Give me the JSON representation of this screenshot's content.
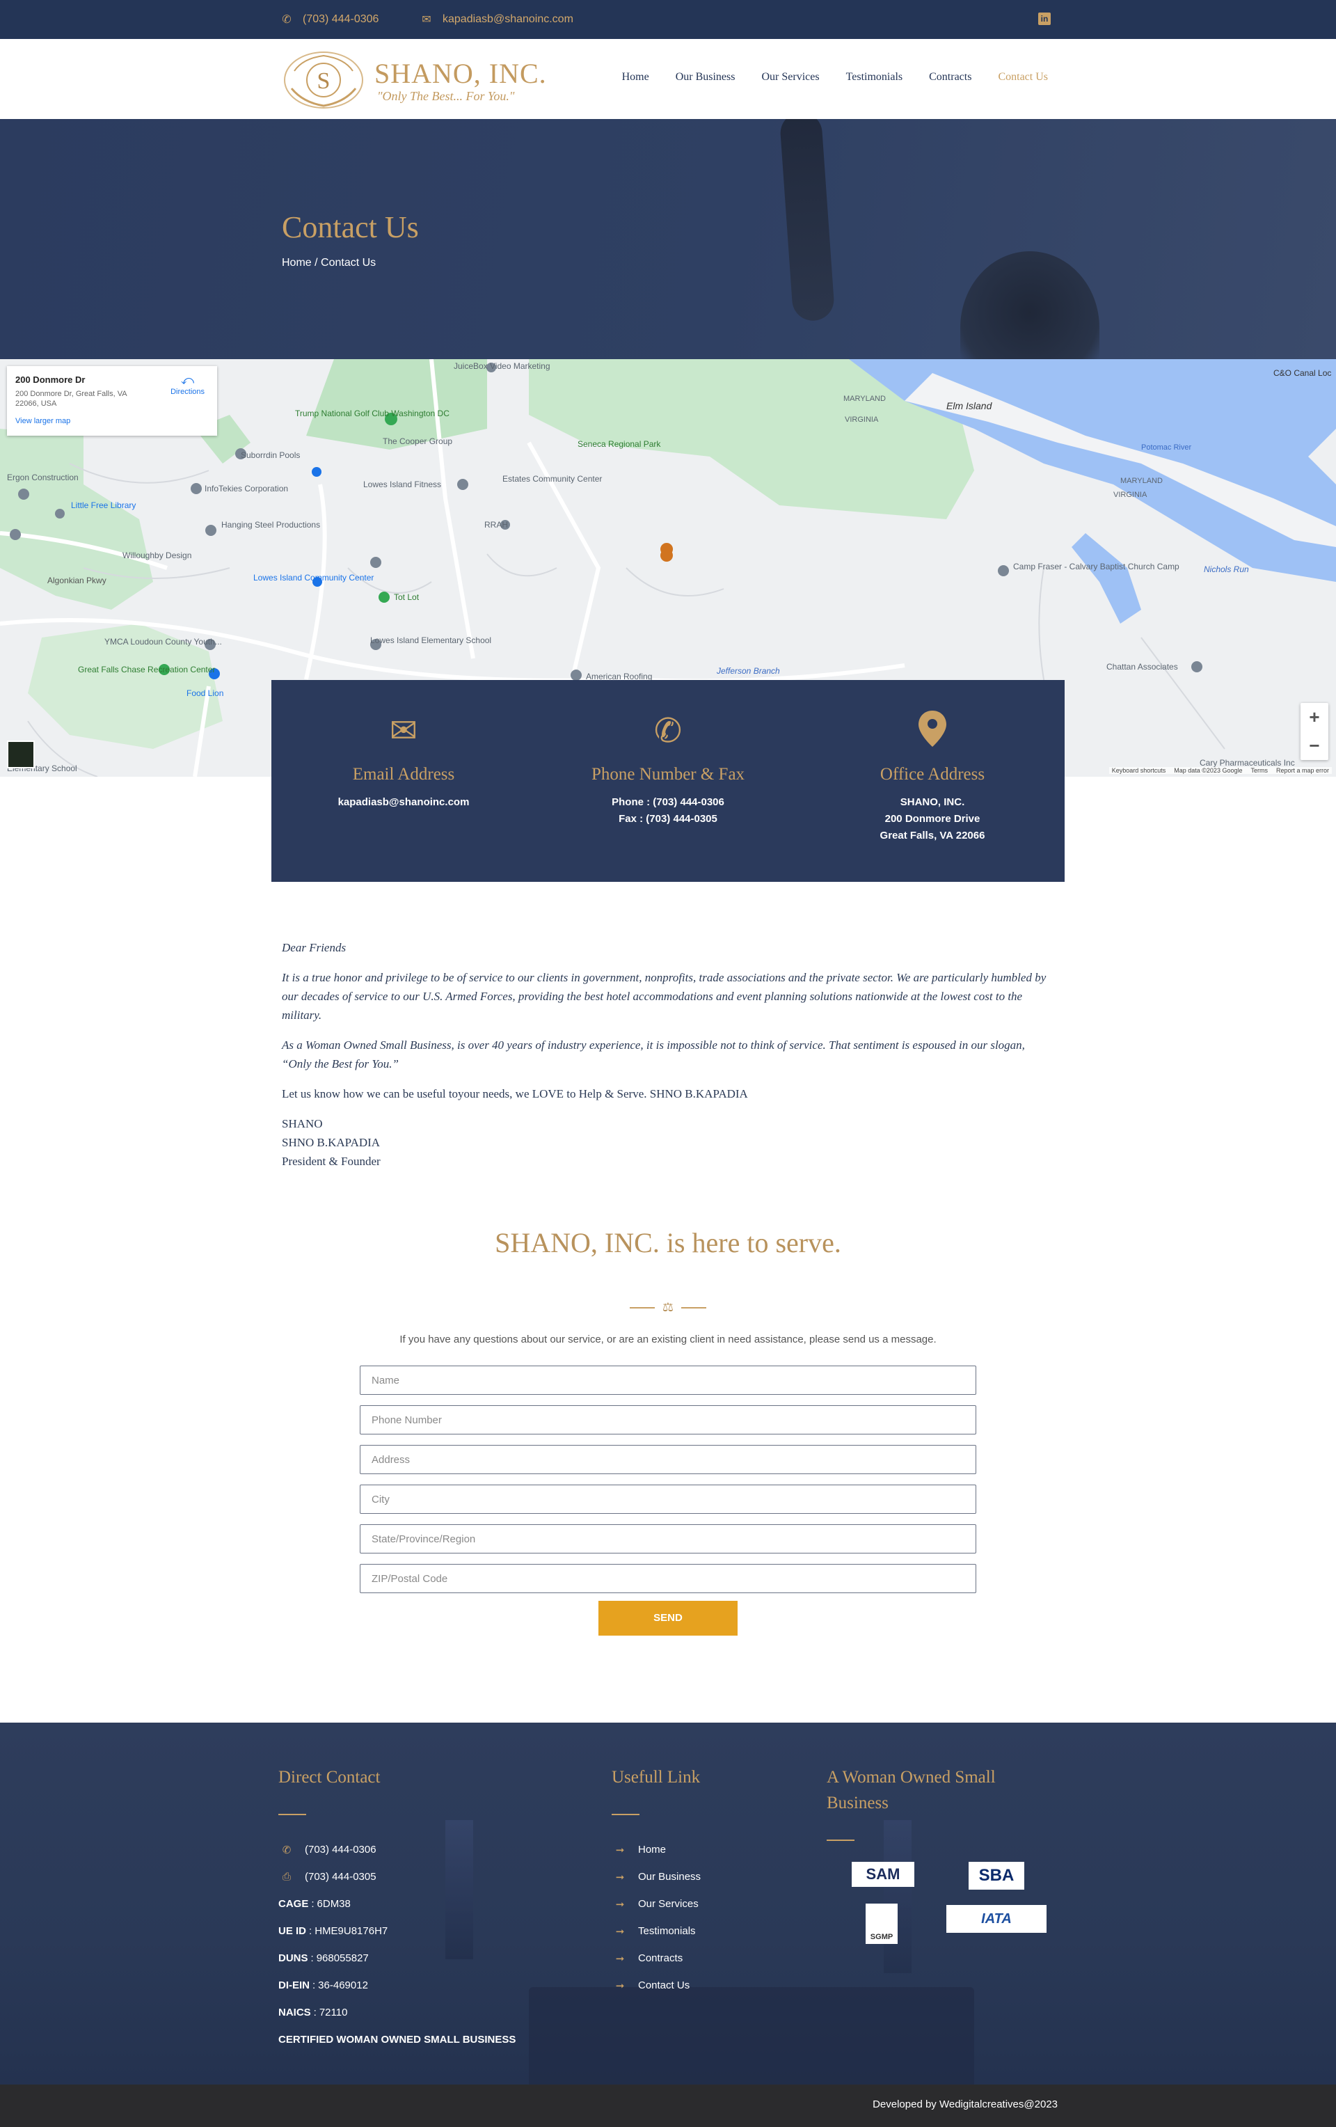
{
  "topbar": {
    "phone": "(703) 444-0306",
    "email": "kapadiasb@shanoinc.com",
    "phone_icon": "phone-icon",
    "email_icon": "envelope-icon",
    "social_icon": "linkedin-icon"
  },
  "header": {
    "logo_monogram": "S",
    "logo_name": "SHANO, INC.",
    "logo_tagline": "\"Only The Best... For You.\"",
    "nav": [
      {
        "label": "Home"
      },
      {
        "label": "Our Business"
      },
      {
        "label": "Our Services"
      },
      {
        "label": "Testimonials"
      },
      {
        "label": "Contracts"
      },
      {
        "label": "Contact Us",
        "active": true
      }
    ]
  },
  "hero": {
    "title": "Contact Us",
    "breadcrumb": "Home / Contact Us"
  },
  "map": {
    "card_title": "200 Donmore Dr",
    "card_address": "200 Donmore Dr, Great Falls, VA 22066, USA",
    "card_link": "View larger map",
    "directions": "Directions",
    "labels": {
      "trump": "Trump National Golf Club Washington DC",
      "cooper": "The Cooper Group",
      "seneca": "Seneca Regional Park",
      "estates": "Estates Community Center",
      "elm": "Elm Island",
      "maryland": "MARYLAND",
      "virginia": "VIRGINIA",
      "potomac": "Potomac River",
      "lowes_fitness": "Lowes Island Fitness",
      "subordin": "Suborrdin Pools",
      "ergon": "Ergon Construction",
      "infotek": "InfoTekies Corporation",
      "library": "Little Free Library",
      "hanging": "Hanging Steel Productions",
      "willoughby": "Willoughby Design",
      "lowes_cc": "Lowes Island Community Center",
      "totlot": "Tot Lot",
      "ymca": "YMCA Loudoun County Youth...",
      "greatfalls": "Great Falls Chase Recreation Center",
      "foodlion": "Food Lion",
      "lowes_school": "Lowes Island Elementary School",
      "camp": "Camp Fraser - Calvary Baptist Church Camp",
      "chattan": "Chattan Associates",
      "jukebox": "JuiceBox Video Marketing",
      "rrah": "RRAH",
      "jefferson": "Jefferson Branch",
      "american": "American Roofing",
      "cary": "Cary Pharmaceuticals Inc",
      "canal": "C&O Canal Loc",
      "algonkian": "Algonkian Pkwy",
      "nichols": "Nichols Run",
      "elementary": "Elementary School"
    },
    "attribution": [
      "Keyboard shortcuts",
      "Map data ©2023 Google",
      "Terms",
      "Report a map error"
    ],
    "zoom_in": "+",
    "zoom_out": "−"
  },
  "info": [
    {
      "icon": "envelope-icon",
      "title": "Email Address",
      "lines": [
        "kapadiasb@shanoinc.com"
      ]
    },
    {
      "icon": "phone-icon",
      "title": "Phone Number & Fax",
      "lines": [
        "Phone : (703) 444-0306",
        "Fax : (703) 444-0305"
      ]
    },
    {
      "icon": "map-pin-icon",
      "title": "Office Address",
      "lines": [
        "SHANO, INC.",
        "200 Donmore Drive",
        "Great Falls, VA 22066"
      ]
    }
  ],
  "letter": {
    "salutation": "Dear Friends",
    "p1": "It is a true honor and privilege to be of service to our clients in government, nonprofits, trade associations and the private sector. We are particularly humbled by our decades of service to our U.S. Armed Forces, providing the best hotel accommodations and event planning solutions nationwide at the lowest cost to the military.",
    "p2": "As a Woman Owned Small Business, is over 40 years of industry experience, it is impossible not to think of service. That sentiment is espoused in our slogan, “Only the Best for You.”",
    "p3": "Let us know how we can be useful toyour needs, we LOVE to Help & Serve. SHNO B.KAPADIA",
    "sig1": "SHANO",
    "sig2": "SHNO B.KAPADIA",
    "sig3": "President & Founder"
  },
  "serve": {
    "title": "SHANO, INC. is here to serve.",
    "subtitle": "If you have any questions about our service, or are an existing client in need assistance, please send us a message.",
    "fields": [
      "Name",
      "Phone Number",
      "Address",
      "City",
      "State/Province/Region",
      "ZIP/Postal Code"
    ],
    "send": "SEND"
  },
  "footer": {
    "direct_title": "Direct Contact",
    "phone": "(703) 444-0306",
    "fax": "(703) 444-0305",
    "details": [
      {
        "label": "CAGE",
        "value": "6DM38"
      },
      {
        "label": "UE ID",
        "value": "HME9U8176H7"
      },
      {
        "label": "DUNS",
        "value": "968055827"
      },
      {
        "label": "DI-EIN",
        "value": "36-469012"
      },
      {
        "label": "NAICS",
        "value": "72110"
      }
    ],
    "certified": "CERTIFIED WOMAN OWNED SMALL BUSINESS",
    "links_title": "Usefull Link",
    "links": [
      "Home",
      "Our Business",
      "Our Services",
      "Testimonials",
      "Contracts",
      "Contact Us"
    ],
    "wosb_title": "A Woman Owned Small Business",
    "logos": [
      "SAM",
      "SBA",
      "SGMP",
      "IATA"
    ],
    "credit": "Developed by Wedigitalcreatives@2023"
  },
  "colors": {
    "navy": "#243556",
    "gold": "#c9a064",
    "send": "#e6a21f"
  }
}
